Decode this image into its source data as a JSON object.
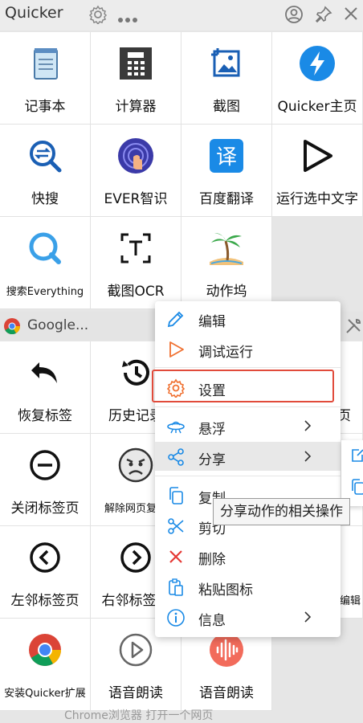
{
  "app": {
    "title": "Quicker"
  },
  "titlebar_icons": [
    "gear-icon",
    "more-icon",
    "user-icon",
    "pin-icon",
    "close-icon"
  ],
  "grid1": [
    {
      "label": "记事本",
      "icon": "notepad-icon"
    },
    {
      "label": "计算器",
      "icon": "calculator-icon"
    },
    {
      "label": "截图",
      "icon": "screenshot-icon"
    },
    {
      "label": "Quicker主页",
      "icon": "lightning-icon"
    },
    {
      "label": "快搜",
      "icon": "quick-search-icon"
    },
    {
      "label": "EVER智识",
      "icon": "fingerprint-icon"
    },
    {
      "label": "百度翻译",
      "icon": "translate-icon"
    },
    {
      "label": "运行选中文字",
      "icon": "play-triangle-icon"
    },
    {
      "label": "搜索Everything",
      "icon": "everything-search-icon"
    },
    {
      "label": "截图OCR",
      "icon": "ocr-icon"
    },
    {
      "label": "动作坞",
      "icon": "palm-tree-icon"
    }
  ],
  "group": {
    "title": "Google..."
  },
  "grid2": [
    {
      "label": "恢复标签",
      "icon": "undo-icon"
    },
    {
      "label": "历史记录",
      "icon": "history-icon"
    },
    {
      "label": "",
      "icon": ""
    },
    {
      "label": "页",
      "icon": ""
    },
    {
      "label": "关闭标签页",
      "icon": "minus-circle-icon"
    },
    {
      "label": "解除网页复制",
      "icon": "angry-face-icon"
    },
    {
      "label": "",
      "icon": ""
    },
    {
      "label": "",
      "icon": ""
    },
    {
      "label": "左邻标签页",
      "icon": "chevron-left-circle-icon"
    },
    {
      "label": "右邻标签页",
      "icon": "chevron-right-circle-icon"
    },
    {
      "label": "",
      "icon": ""
    },
    {
      "label": "编辑",
      "icon": ""
    },
    {
      "label": "安装Quicker扩展",
      "icon": "chrome-icon"
    },
    {
      "label": "语音朗读",
      "icon": "play-circle-icon"
    },
    {
      "label": "语音朗读",
      "icon": "audio-wave-icon"
    }
  ],
  "bottom_text": "Chrome浏览器  打开一个网页",
  "menu": {
    "items": [
      {
        "label": "编辑",
        "icon": "pencil-icon"
      },
      {
        "label": "调试运行",
        "icon": "play-outline-icon"
      },
      {
        "label": "设置",
        "icon": "gear-icon"
      },
      {
        "label": "悬浮",
        "icon": "ufo-icon"
      },
      {
        "label": "分享",
        "icon": "share-icon"
      },
      {
        "label": "复制",
        "icon": "copy-icon"
      },
      {
        "label": "剪切",
        "icon": "scissors-icon"
      },
      {
        "label": "删除",
        "icon": "delete-x-icon"
      },
      {
        "label": "粘贴图标",
        "icon": "paste-icon"
      },
      {
        "label": "信息",
        "icon": "info-icon"
      }
    ]
  },
  "tooltip": "分享动作的相关操作",
  "colors": {
    "accent_blue": "#1a8ae6",
    "highlight_red": "#e14b3b",
    "play_orange": "#f07030",
    "delete_red": "#e53935"
  }
}
